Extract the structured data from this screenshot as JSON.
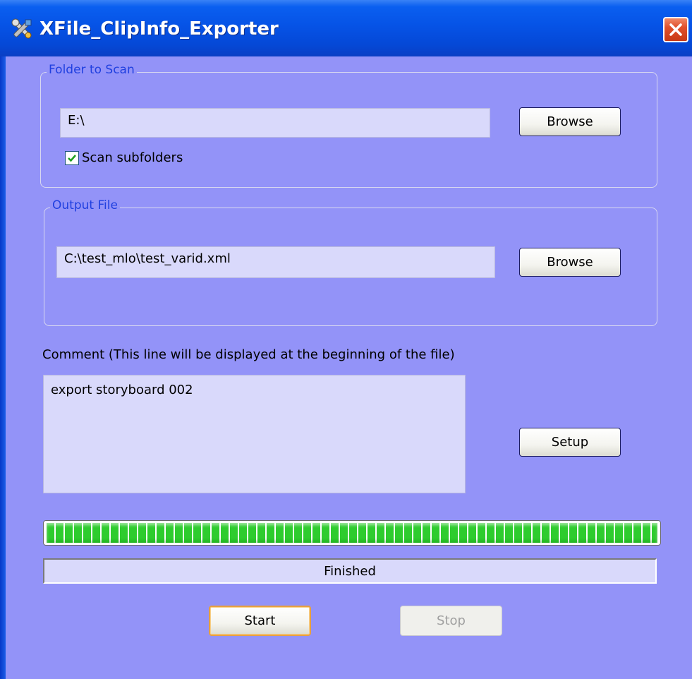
{
  "window": {
    "title": "XFile_ClipInfo_Exporter",
    "icon": "tools-icon"
  },
  "folder_group": {
    "legend": "Folder to Scan",
    "path_value": "E:\\",
    "browse_label": "Browse",
    "scan_subfolders_label": "Scan subfolders",
    "scan_subfolders_checked": true
  },
  "output_group": {
    "legend": "Output File",
    "path_value": "C:\\test_mlo\\test_varid.xml",
    "browse_label": "Browse"
  },
  "comment": {
    "label": "Comment (This line will be displayed at the beginning of the file)",
    "value": "export storyboard 002"
  },
  "setup_label": "Setup",
  "progress": {
    "value": 1.0,
    "color": "#2ecc2e"
  },
  "status_text": "Finished",
  "start_label": "Start",
  "stop_label": "Stop",
  "colors": {
    "background": "#9393f8",
    "titlebar": "#0653e6",
    "legend": "#2040e0"
  }
}
